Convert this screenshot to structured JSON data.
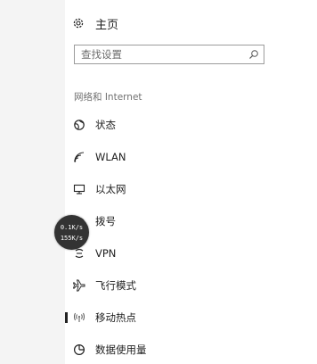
{
  "nav": {
    "home_label": "主页",
    "search_placeholder": "查找设置",
    "section_title": "网络和 Internet",
    "items": [
      {
        "label": "状态",
        "icon": "globe-icon"
      },
      {
        "label": "WLAN",
        "icon": "wifi-icon"
      },
      {
        "label": "以太网",
        "icon": "ethernet-icon"
      },
      {
        "label": "拨号",
        "icon": "dialup-icon"
      },
      {
        "label": "VPN",
        "icon": "vpn-icon"
      },
      {
        "label": "飞行模式",
        "icon": "airplane-icon"
      },
      {
        "label": "移动热点",
        "icon": "hotspot-icon",
        "selected": true
      },
      {
        "label": "数据使用量",
        "icon": "data-usage-icon"
      }
    ]
  },
  "speed_widget": {
    "upload": "0.1K/s",
    "download": "155K/s"
  }
}
